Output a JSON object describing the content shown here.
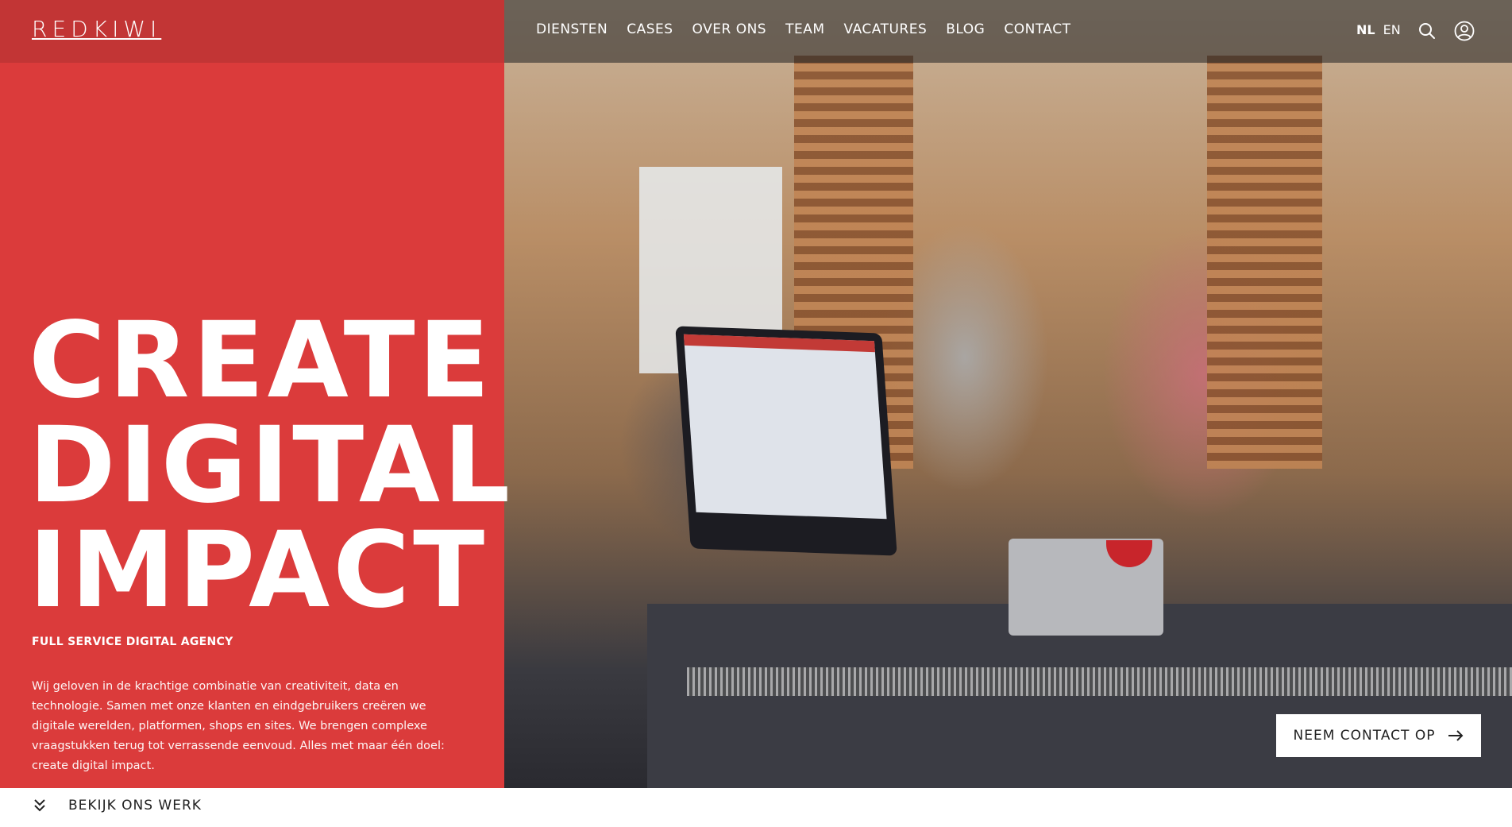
{
  "brand": {
    "logo": "REDKIWI"
  },
  "nav": {
    "items": [
      {
        "label": "DIENSTEN"
      },
      {
        "label": "CASES"
      },
      {
        "label": "OVER ONS"
      },
      {
        "label": "TEAM"
      },
      {
        "label": "VACATURES"
      },
      {
        "label": "BLOG"
      },
      {
        "label": "CONTACT"
      }
    ],
    "languages": {
      "active": "NL",
      "other": "EN"
    },
    "icons": {
      "search": "search-icon",
      "account": "user-icon"
    }
  },
  "hero": {
    "headline_lines": [
      "CREATE",
      "DIGITAL",
      "IMPACT"
    ],
    "subheading": "FULL SERVICE DIGITAL AGENCY",
    "intro": "Wij geloven in de krachtige combinatie van creativiteit, data en technologie. Samen met onze klanten en eindgebruikers creëren we digitale werelden, platformen, shops en sites. We brengen complexe vraagstukken terug tot verrassende eenvoud. Alles met maar één doel: create digital impact.",
    "cta_label": "NEEM CONTACT OP",
    "cta_icon": "arrow-right-icon"
  },
  "footer_link": {
    "label": "BEKIJK ONS WERK",
    "icon": "chevron-double-down-icon"
  },
  "colors": {
    "brand_red": "#db3b3b",
    "header_red": "#c23535",
    "cta_bg": "#ffffff"
  }
}
